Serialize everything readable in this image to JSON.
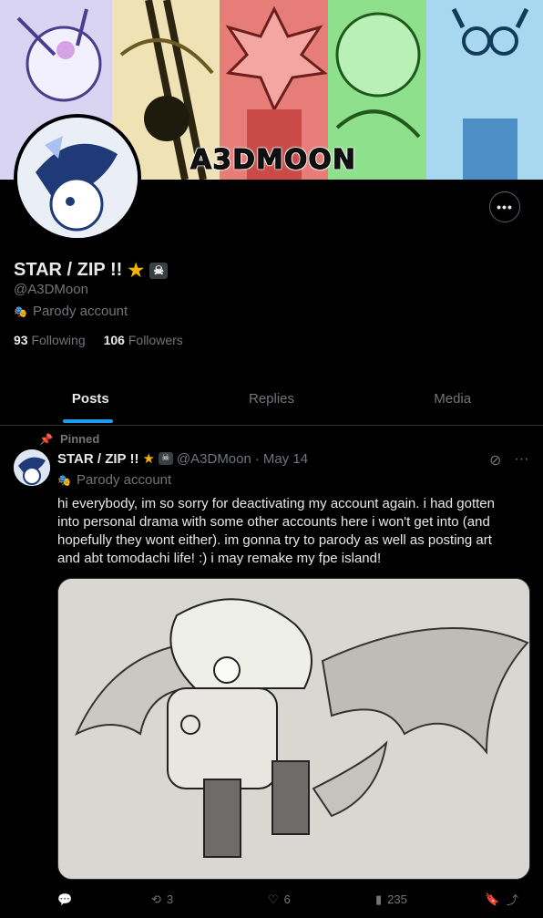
{
  "banner": {
    "title": "A3DMOON"
  },
  "profile": {
    "display_name": "STAR / ZIP !!",
    "handle": "@A3DMoon",
    "badge": "Parody account",
    "following_count": "93",
    "following_label": "Following",
    "followers_count": "106",
    "followers_label": "Followers"
  },
  "tabs": [
    {
      "label": "Posts",
      "active": true
    },
    {
      "label": "Replies",
      "active": false
    },
    {
      "label": "Media",
      "active": false
    }
  ],
  "tweet": {
    "pinned_label": "Pinned",
    "display_name": "STAR / ZIP !!",
    "handle": "@A3DMoon",
    "separator": "·",
    "date": "May 14",
    "badge": "Parody account",
    "text": "hi everybody, im so sorry for deactivating my account again. i had gotten into personal drama with some other accounts here i won't get into (and hopefully they wont either). im gonna try to parody as well as posting art and abt tomodachi life! :) i may remake my fpe island!",
    "retweets": "3",
    "likes": "6",
    "views": "235"
  },
  "colors": {
    "accent": "#1d9bf0",
    "muted": "#71767b",
    "text": "#e7e9ea",
    "border": "#2f3336"
  }
}
